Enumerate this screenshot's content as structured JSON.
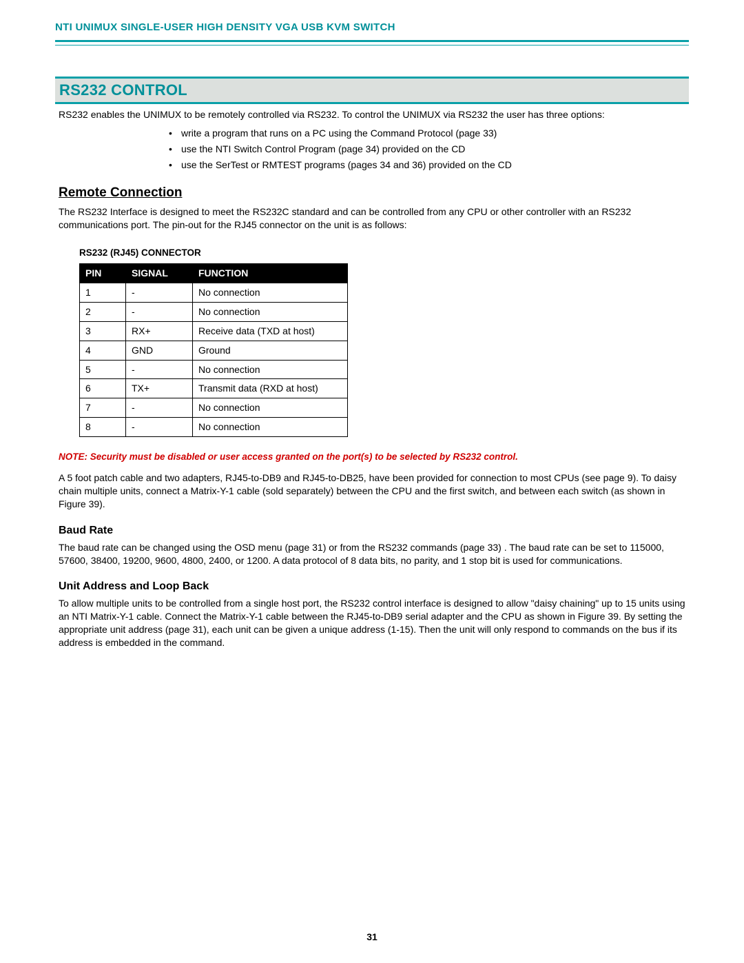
{
  "header": {
    "title": "NTI UNIMUX SINGLE-USER HIGH DENSITY VGA USB KVM SWITCH"
  },
  "banner": "RS232 CONTROL",
  "intro": "RS232 enables the UNIMUX to be remotely controlled via RS232.   To control the UNIMUX via RS232 the user has three options:",
  "bullets": [
    "write a program that runs on a PC using the Command Protocol (page 33)",
    "use the NTI Switch Control Program (page 34) provided on the CD",
    "use the SerTest or RMTEST programs (pages 34 and 36) provided on the CD"
  ],
  "remote": {
    "heading": "Remote Connection",
    "para": "The RS232 Interface is designed to meet the RS232C standard and can be controlled from any CPU or other controller with an RS232 communications port. The pin-out for the RJ45 connector on the unit is as follows:"
  },
  "table": {
    "title": "RS232 (RJ45) CONNECTOR",
    "headers": {
      "pin": "PIN",
      "signal": "SIGNAL",
      "func": "FUNCTION"
    },
    "rows": [
      {
        "pin": "1",
        "signal": "-",
        "func": "No connection"
      },
      {
        "pin": "2",
        "signal": "-",
        "func": "No connection"
      },
      {
        "pin": "3",
        "signal": "RX+",
        "func": "Receive data (TXD at host)"
      },
      {
        "pin": "4",
        "signal": "GND",
        "func": "Ground"
      },
      {
        "pin": "5",
        "signal": "-",
        "func": "No connection"
      },
      {
        "pin": "6",
        "signal": "TX+",
        "func": "Transmit data (RXD at host)"
      },
      {
        "pin": "7",
        "signal": "-",
        "func": "No connection"
      },
      {
        "pin": "8",
        "signal": "-",
        "func": "No connection"
      }
    ]
  },
  "note": "NOTE: Security must be disabled or user access granted on the port(s) to be selected by RS232 control.",
  "patch": "A 5 foot patch cable and two adapters, RJ45-to-DB9 and RJ45-to-DB25, have been provided for connection to most CPUs (see page 9).     To daisy chain multiple units, connect a Matrix-Y-1 cable (sold separately) between the CPU and the first switch, and between each switch (as shown in Figure 39).",
  "baud": {
    "heading": "Baud Rate",
    "para": "The baud rate can be changed using the OSD menu (page 31) or from the RS232 commands (page 33) .  The baud rate can be set to 115000, 57600, 38400, 19200, 9600, 4800, 2400, or 1200.  A data protocol of 8 data bits, no parity, and 1 stop bit is used for communications."
  },
  "loop": {
    "heading": "Unit Address and Loop Back",
    "para": "To allow multiple units to be controlled from a single host port, the RS232 control interface is designed to allow \"daisy chaining\" up to 15 units using an NTI Matrix-Y-1 cable.  Connect the Matrix-Y-1 cable between the RJ45-to-DB9 serial adapter and the CPU as shown in Figure 39.   By setting the appropriate unit address (page 31), each unit can be given a unique address (1-15). Then the unit will only respond to commands on the bus if its address is embedded in the command."
  },
  "page_number": "31"
}
